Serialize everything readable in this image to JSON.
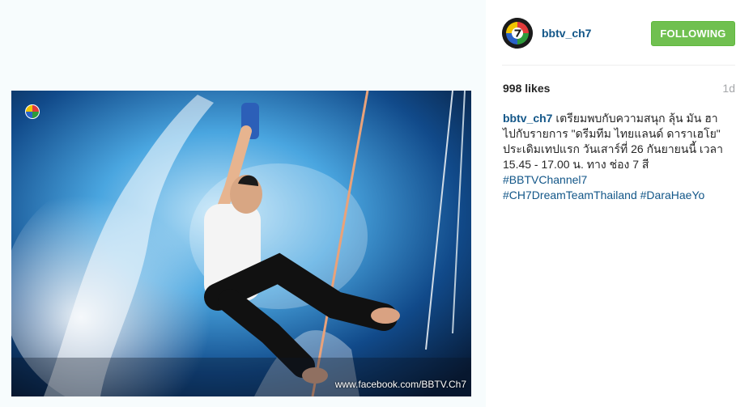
{
  "post": {
    "image_alt": "Man hanging from rope over splashing water",
    "watermark": "www.facebook.com/BBTV.Ch7",
    "brand_color": "#125688"
  },
  "header": {
    "username": "bbtv_ch7",
    "follow_label": "FOLLOWING",
    "follow_color": "#70c050"
  },
  "stats": {
    "likes": "998 likes",
    "age": "1d"
  },
  "caption": {
    "username": "bbtv_ch7",
    "lines": [
      "เตรียมพบกับความสนุก ลุ้น มัน ฮา",
      "ไปกับรายการ \"ดรีมทีม ไทยแลนด์ ดาราเฮโย\"",
      "ประเดิมเทปแรก วันเสาร์ที่ 26 กันยายนนี้ เวลา",
      "15.45 - 17.00 น. ทาง ช่อง 7 สี"
    ],
    "hashtags": [
      "#BBTVChannel7",
      "#CH7DreamTeamThailand",
      "#DaraHaeYo"
    ]
  },
  "icons": {
    "avatar": "channel7-logo-icon",
    "photo_logo": "channel7-logo-icon"
  }
}
